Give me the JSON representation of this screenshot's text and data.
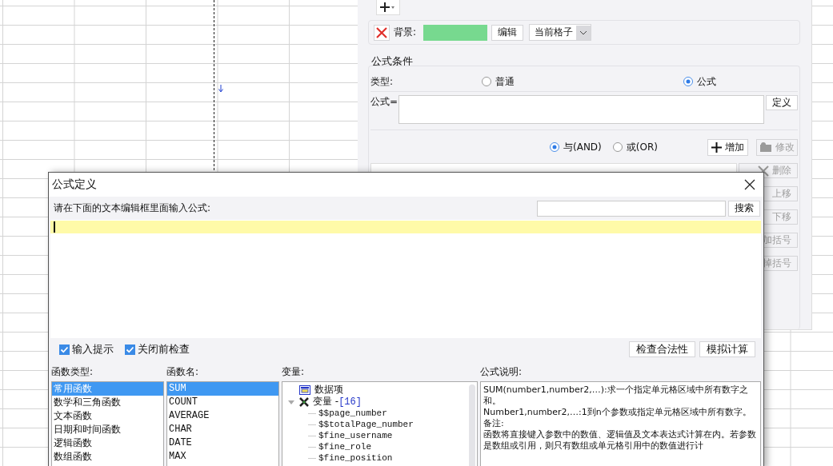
{
  "format_panel": {
    "background": {
      "label": "背景:",
      "color": "#77d98f",
      "edit_button": "编辑",
      "scope": "当前格子"
    }
  },
  "formula_condition": {
    "legend": "公式条件",
    "type_label": "类型:",
    "types": [
      {
        "label": "普通",
        "selected": false
      },
      {
        "label": "公式",
        "selected": true
      }
    ],
    "formula_label": "公式=",
    "define_button": "定义",
    "logic": [
      {
        "label": "与(AND)",
        "selected": true
      },
      {
        "label": "或(OR)",
        "selected": false
      }
    ],
    "add_button": "增加",
    "modify_button": {
      "label": "修改",
      "disabled": true
    },
    "side_buttons": [
      {
        "label": "删除",
        "disabled": true
      },
      {
        "label": "上移",
        "disabled": true
      },
      {
        "label": "下移",
        "disabled": true
      },
      {
        "label": "加括号",
        "disabled": true
      },
      {
        "label": "掉括号",
        "disabled": true
      }
    ]
  },
  "dialog": {
    "title": "公式定义",
    "prompt": "请在下面的文本编辑框里面输入公式:",
    "search_button": "搜索",
    "options": [
      {
        "label": "输入提示",
        "checked": true
      },
      {
        "label": "关闭前检查",
        "checked": true
      }
    ],
    "buttons": [
      "检查合法性",
      "模拟计算"
    ],
    "function_types": {
      "label": "函数类型:",
      "items": [
        {
          "label": "常用函数",
          "selected": true
        },
        {
          "label": "数学和三角函数",
          "selected": false
        },
        {
          "label": "文本函数",
          "selected": false
        },
        {
          "label": "日期和时间函数",
          "selected": false
        },
        {
          "label": "逻辑函数",
          "selected": false
        },
        {
          "label": "数组函数",
          "selected": false
        }
      ]
    },
    "function_names": {
      "label": "函数名:",
      "items": [
        {
          "label": "SUM",
          "selected": true
        },
        {
          "label": "COUNT",
          "selected": false
        },
        {
          "label": "AVERAGE",
          "selected": false
        },
        {
          "label": "CHAR",
          "selected": false
        },
        {
          "label": "DATE",
          "selected": false
        },
        {
          "label": "MAX",
          "selected": false
        }
      ]
    },
    "variables": {
      "label": "变量:",
      "tree": [
        {
          "kind": "data",
          "label": "数据项"
        },
        {
          "kind": "group",
          "label": "变量 - ",
          "count": "[16]",
          "expanded": true,
          "children": [
            "$$page_number",
            "$$totalPage_number",
            "$fine_username",
            "$fine_role",
            "$fine_position"
          ]
        }
      ]
    },
    "description": {
      "label": "公式说明:",
      "paragraphs": [
        "SUM(number1,number2,…):求一个指定单元格区域中所有数字之和。",
        "Number1,number2,…:1到n个参数或指定单元格区域中所有数字。",
        "备注:",
        "函数将直接键入参数中的数值、逻辑值及文本表达式计算在内。若参数是数组或引用，则只有数组或单元格引用中的数值进行计"
      ]
    }
  }
}
